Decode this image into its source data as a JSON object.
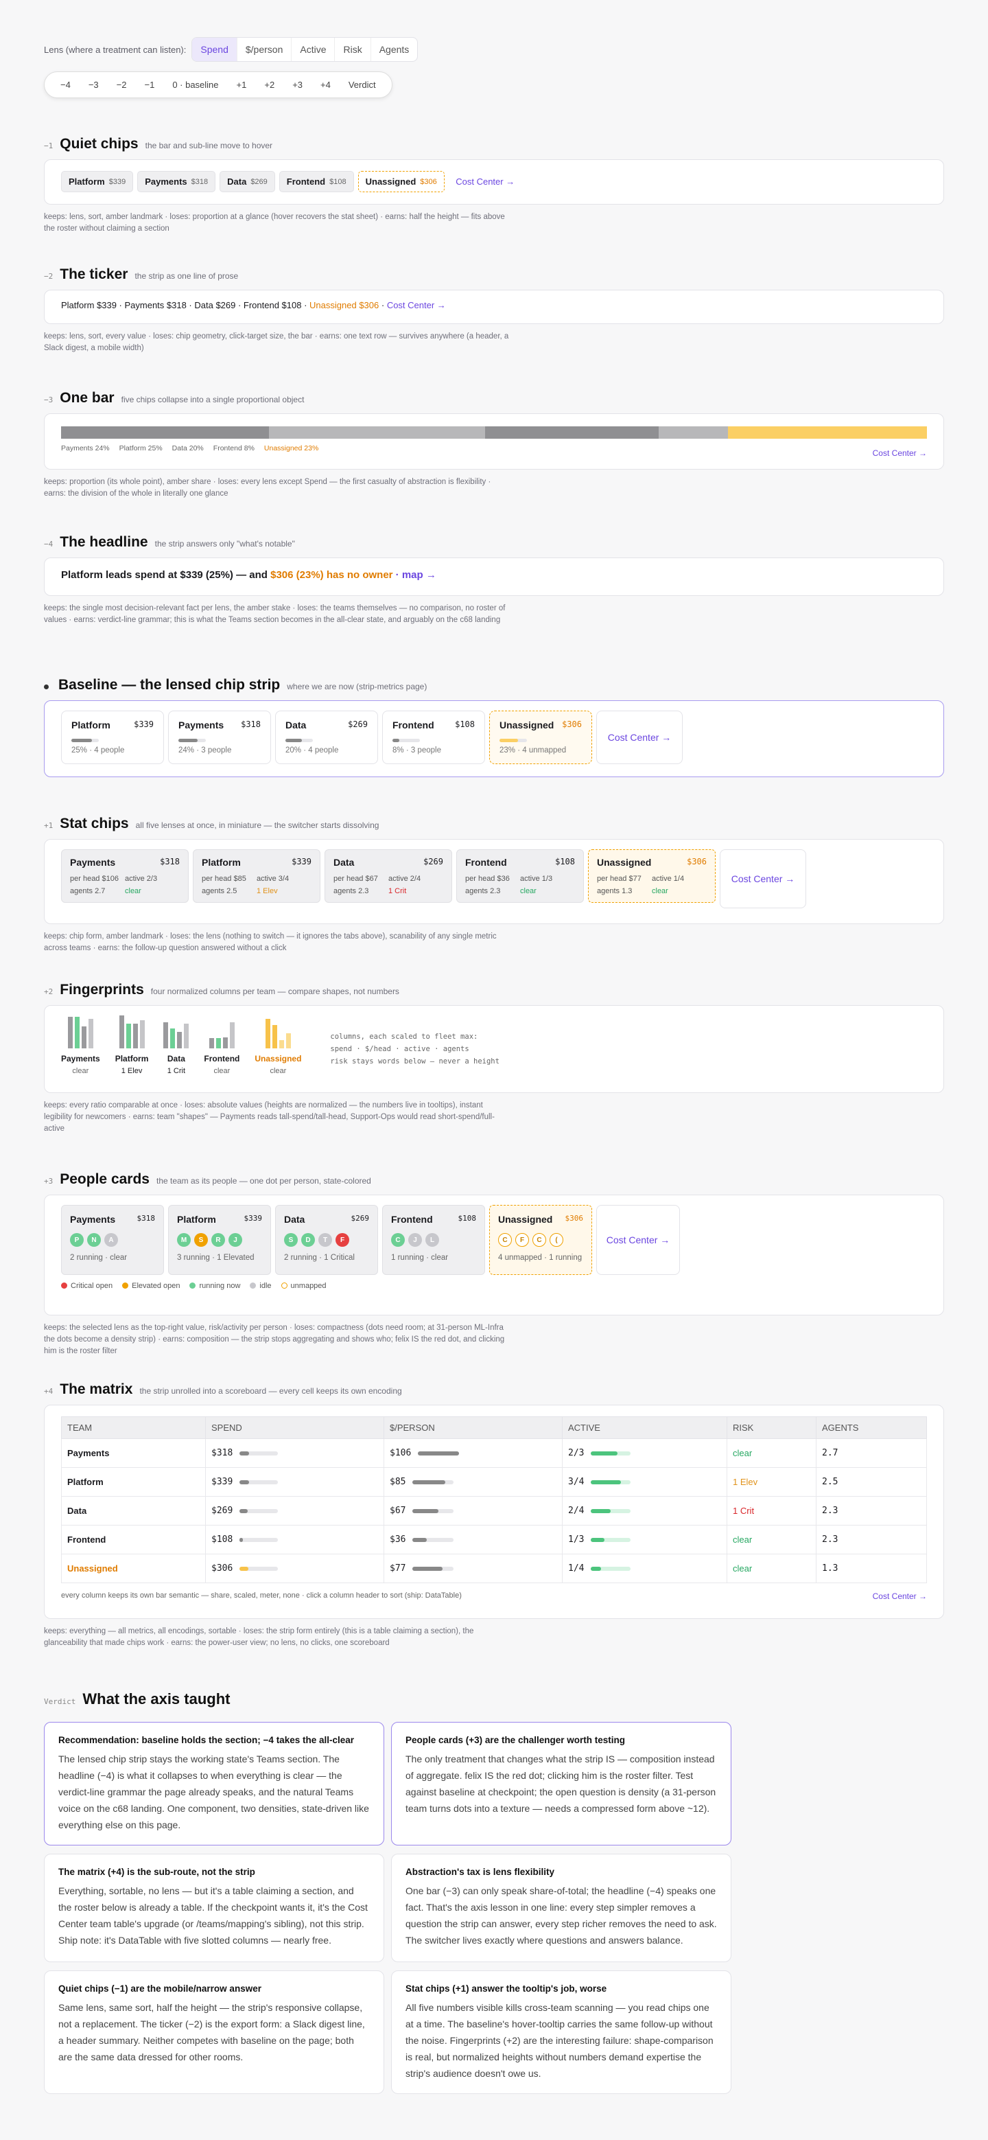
{
  "lens": {
    "label": "Lens (where a treatment can listen):",
    "options": [
      "Spend",
      "$/person",
      "Active",
      "Risk",
      "Agents"
    ],
    "active": "Spend"
  },
  "axis": [
    "−4",
    "−3",
    "−2",
    "−1",
    "0 · baseline",
    "+1",
    "+2",
    "+3",
    "+4",
    "Verdict"
  ],
  "s_m1": {
    "num": "−1",
    "title": "Quiet chips",
    "sub": "the bar and sub-line move to hover",
    "chips": [
      {
        "n": "Platform",
        "v": "$339"
      },
      {
        "n": "Payments",
        "v": "$318"
      },
      {
        "n": "Data",
        "v": "$269"
      },
      {
        "n": "Frontend",
        "v": "$108"
      }
    ],
    "unassigned": {
      "n": "Unassigned",
      "v": "$306"
    },
    "cc": "Cost Center →",
    "keeps": "keeps: lens, sort, amber landmark · loses: proportion at a glance (hover recovers the stat sheet) · earns: half the height — fits above the roster without claiming a section"
  },
  "s_m2": {
    "num": "−2",
    "title": "The ticker",
    "sub": "the strip as one line of prose",
    "text": "Platform $339 · Payments $318 · Data $269 · Frontend $108 · ",
    "un": "Unassigned $306",
    "sep": " · ",
    "cc": "Cost Center →",
    "keeps": "keeps: lens, sort, every value · loses: chip geometry, click-target size, the bar · earns: one text row — survives anywhere (a header, a Slack digest, a mobile width)"
  },
  "s_m3": {
    "num": "−3",
    "title": "One bar",
    "sub": "five chips collapse into a single proportional object",
    "labels": [
      "Payments 24%",
      "Platform 25%",
      "Data 20%",
      "Frontend 8%"
    ],
    "unlabel": "Unassigned 23%",
    "cc": "Cost Center →",
    "keeps": "keeps: proportion (its whole point), amber share · loses: every lens except Spend — the first casualty of abstraction is flexibility · earns: the division of the whole in literally one glance"
  },
  "s_m4": {
    "num": "−4",
    "title": "The headline",
    "sub": "the strip answers only \"what's notable\"",
    "text": "Platform leads spend at $339 (25%) — and ",
    "un": "$306 (23%) has no owner",
    "map": " · map →",
    "keeps": "keeps: the single most decision-relevant fact per lens, the amber stake · loses: the teams themselves — no comparison, no roster of values · earns: verdict-line grammar; this is what the Teams section becomes in the all-clear state, and arguably on the c68 landing"
  },
  "s_0": {
    "title": "Baseline — the lensed chip strip",
    "sub": "where we are now (strip-metrics page)",
    "cards": [
      {
        "n": "Platform",
        "v": "$339",
        "s": "25% · 4 people"
      },
      {
        "n": "Payments",
        "v": "$318",
        "s": "24% · 3 people"
      },
      {
        "n": "Data",
        "v": "$269",
        "s": "20% · 4 people"
      },
      {
        "n": "Frontend",
        "v": "$108",
        "s": "8% · 3 people"
      }
    ],
    "un": {
      "n": "Unassigned",
      "v": "$306",
      "s": "23% · 4 unmapped"
    },
    "cc": "Cost Center →"
  },
  "s_p1": {
    "num": "+1",
    "title": "Stat chips",
    "sub": "all five lenses at once, in miniature — the switcher starts dissolving",
    "cards": [
      {
        "n": "Payments",
        "v": "$318",
        "ph": "per head $106",
        "ac": "active 2/3",
        "ag": "agents 2.7",
        "rk": "clear",
        "rc": "green"
      },
      {
        "n": "Platform",
        "v": "$339",
        "ph": "per head $85",
        "ac": "active 3/4",
        "ag": "agents 2.5",
        "rk": "1 Elev",
        "rc": "amber"
      },
      {
        "n": "Data",
        "v": "$269",
        "ph": "per head $67",
        "ac": "active 2/4",
        "ag": "agents 2.3",
        "rk": "1 Crit",
        "rc": "red"
      },
      {
        "n": "Frontend",
        "v": "$108",
        "ph": "per head $36",
        "ac": "active 1/3",
        "ag": "agents 2.3",
        "rk": "clear",
        "rc": "green"
      },
      {
        "n": "Unassigned",
        "v": "$306",
        "ph": "per head $77",
        "ac": "active 1/4",
        "ag": "agents 1.3",
        "rk": "clear",
        "rc": "green",
        "un": true
      }
    ],
    "cc": "Cost Center →",
    "keeps": "keeps: chip form, amber landmark · loses: the lens (nothing to switch — it ignores the tabs above), scanability of any single metric across teams · earns: the follow-up question answered without a click"
  },
  "s_p2": {
    "num": "+2",
    "title": "Fingerprints",
    "sub": "four normalized columns per team — compare shapes, not numbers",
    "teams": [
      {
        "n": "Payments",
        "rk": "clear",
        "rc": "muted",
        "c": [
          0.95,
          0.95,
          0.67,
          0.9
        ]
      },
      {
        "n": "Platform",
        "rk": "1 Elev",
        "rc": "amber",
        "c": [
          1,
          0.76,
          0.75,
          0.85
        ]
      },
      {
        "n": "Data",
        "rk": "1 Crit",
        "rc": "red",
        "c": [
          0.8,
          0.6,
          0.5,
          0.75
        ]
      },
      {
        "n": "Frontend",
        "rk": "clear",
        "rc": "muted",
        "c": [
          0.32,
          0.32,
          0.33,
          0.8
        ]
      },
      {
        "n": "Unassigned",
        "rk": "clear",
        "rc": "muted",
        "un": true,
        "c": [
          0.9,
          0.7,
          0.25,
          0.45
        ]
      }
    ],
    "note1": "columns, each scaled to fleet max:",
    "note2": "spend · $/head · active · agents",
    "note3": "risk stays words below — never a height",
    "keeps": "keeps: every ratio comparable at once · loses: absolute values (heights are normalized — the numbers live in tooltips), instant legibility for newcomers · earns: team \"shapes\" — Payments reads tall-spend/tall-head, Support-Ops would read short-spend/full-active"
  },
  "s_p3": {
    "num": "+3",
    "title": "People cards",
    "sub": "the team as its people — one dot per person, state-colored",
    "cards": [
      {
        "n": "Payments",
        "v": "$318",
        "d": [
          [
            "P",
            "g"
          ],
          [
            "N",
            "g"
          ],
          [
            "A",
            "i"
          ]
        ],
        "s": "2 running · clear"
      },
      {
        "n": "Platform",
        "v": "$339",
        "d": [
          [
            "M",
            "g"
          ],
          [
            "S",
            "o"
          ],
          [
            "R",
            "g"
          ],
          [
            "J",
            "g"
          ]
        ],
        "s": "3 running · 1 Elevated"
      },
      {
        "n": "Data",
        "v": "$269",
        "d": [
          [
            "S",
            "g"
          ],
          [
            "D",
            "g"
          ],
          [
            "T",
            "i"
          ],
          [
            "F",
            "r"
          ]
        ],
        "s": "2 running · 1 Critical"
      },
      {
        "n": "Frontend",
        "v": "$108",
        "d": [
          [
            "C",
            "g"
          ],
          [
            "J",
            "i"
          ],
          [
            "L",
            "i"
          ]
        ],
        "s": "1 running · clear"
      },
      {
        "n": "Unassigned",
        "v": "$306",
        "d": [
          [
            "C",
            "u"
          ],
          [
            "F",
            "u"
          ],
          [
            "C",
            "u"
          ],
          [
            "(",
            "u"
          ]
        ],
        "s": "4 unmapped · 1 running",
        "un": true
      }
    ],
    "cc": "Cost Center →",
    "legend": [
      "Critical open",
      "Elevated open",
      "running now",
      "idle",
      "unmapped"
    ],
    "keeps": "keeps: the selected lens as the top-right value, risk/activity per person · loses: compactness (dots need room; at 31-person ML-Infra the dots become a density strip) · earns: composition — the strip stops aggregating and shows who; felix IS the red dot, and clicking him is the roster filter"
  },
  "s_p4": {
    "num": "+4",
    "title": "The matrix",
    "sub": "the strip unrolled into a scoreboard — every cell keeps its own encoding",
    "cols": [
      "TEAM",
      "SPEND",
      "$/PERSON",
      "ACTIVE",
      "RISK",
      "AGENTS"
    ],
    "rows": [
      {
        "t": "Payments",
        "sp": "$318",
        "spf": 0.94,
        "pp": "$106",
        "ppf": 1.0,
        "ac": "2/3",
        "acf": 0.67,
        "rk": "clear",
        "rc": "green",
        "ag": "2.7"
      },
      {
        "t": "Platform",
        "sp": "$339",
        "spf": 1.0,
        "pp": "$85",
        "ppf": 0.8,
        "ac": "3/4",
        "acf": 0.75,
        "rk": "1 Elev",
        "rc": "amber",
        "ag": "2.5"
      },
      {
        "t": "Data",
        "sp": "$269",
        "spf": 0.79,
        "pp": "$67",
        "ppf": 0.63,
        "ac": "2/4",
        "acf": 0.5,
        "rk": "1 Crit",
        "rc": "red",
        "ag": "2.3"
      },
      {
        "t": "Frontend",
        "sp": "$108",
        "spf": 0.32,
        "pp": "$36",
        "ppf": 0.34,
        "ac": "1/3",
        "acf": 0.33,
        "rk": "clear",
        "rc": "green",
        "ag": "2.3"
      },
      {
        "t": "Unassigned",
        "sp": "$306",
        "spf": 0.9,
        "pp": "$77",
        "ppf": 0.73,
        "ac": "1/4",
        "acf": 0.25,
        "rk": "clear",
        "rc": "green",
        "ag": "1.3",
        "un": true
      }
    ],
    "foot": "every column keeps its own bar semantic — share, scaled, meter, none · click a column header to sort (ship: DataTable)",
    "cc": "Cost Center →",
    "keeps": "keeps: everything — all metrics, all encodings, sortable · loses: the strip form entirely (this is a table claiming a section), the glanceability that made chips work · earns: the power-user view; no lens, no clicks, one scoreboard"
  },
  "verdict": {
    "tag": "Verdict",
    "title": "What the axis taught",
    "cards": [
      {
        "t": "Recommendation: baseline holds the section; −4 takes the all-clear",
        "b": "The lensed chip strip stays the working state's Teams section. The headline (−4) is what it collapses to when everything is clear — the verdict-line grammar the page already speaks, and the natural Teams voice on the c68 landing. One component, two densities, state-driven like everything else on this page."
      },
      {
        "t": "People cards (+3) are the challenger worth testing",
        "b": "The only treatment that changes what the strip IS — composition instead of aggregate. felix IS the red dot; clicking him is the roster filter. Test against baseline at checkpoint; the open question is density (a 31-person team turns dots into a texture — needs a compressed form above ~12)."
      },
      {
        "t": "The matrix (+4) is the sub-route, not the strip",
        "b": "Everything, sortable, no lens — but it's a table claiming a section, and the roster below is already a table. If the checkpoint wants it, it's the Cost Center team table's upgrade (or /teams/mapping's sibling), not this strip. Ship note: it's DataTable with five slotted columns — nearly free."
      },
      {
        "t": "Abstraction's tax is lens flexibility",
        "b": "One bar (−3) can only speak share-of-total; the headline (−4) speaks one fact. That's the axis lesson in one line: every step simpler removes a question the strip can answer, every step richer removes the need to ask. The switcher lives exactly where questions and answers balance."
      },
      {
        "t": "Quiet chips (−1) are the mobile/narrow answer",
        "b": "Same lens, same sort, half the height — the strip's responsive collapse, not a replacement. The ticker (−2) is the export form: a Slack digest line, a header summary. Neither competes with baseline on the page; both are the same data dressed for other rooms."
      },
      {
        "t": "Stat chips (+1) answer the tooltip's job, worse",
        "b": "All five numbers visible kills cross-team scanning — you read chips one at a time. The baseline's hover-tooltip carries the same follow-up without the noise. Fingerprints (+2) are the interesting failure: shape-comparison is real, but normalized heights without numbers demand expertise the strip's audience doesn't owe us."
      }
    ]
  }
}
